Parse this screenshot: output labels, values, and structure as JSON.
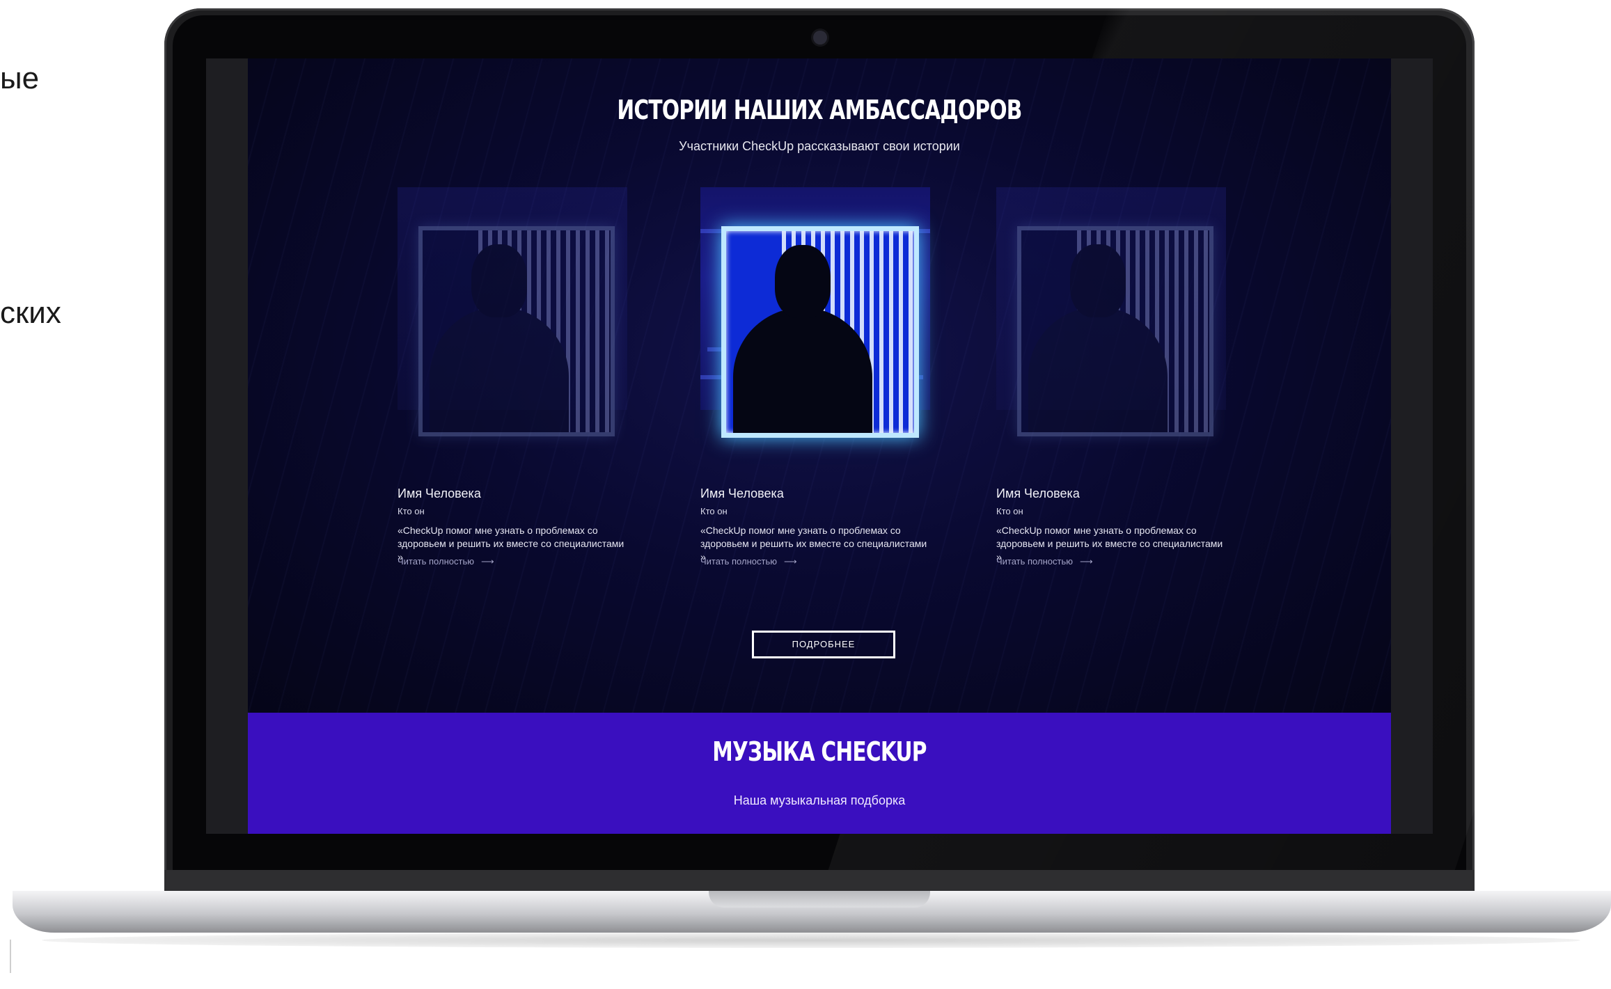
{
  "page_side_text": [
    "ые",
    "ских"
  ],
  "screen": {
    "stories": {
      "title": "ИСТОРИИ НАШИХ АМБАССАДОРОВ",
      "subtitle": "Участники CheckUp рассказывают свои истории",
      "cards": [
        {
          "name": "Имя Человека",
          "role": "Кто он",
          "quote": "«CheckUp помог мне узнать о проблемах со здоровьем и решить их вместе со специалистами »",
          "read_more": "Читать полностью",
          "arrow": "⟶",
          "state": "dim"
        },
        {
          "name": "Имя Человека",
          "role": "Кто он",
          "quote": "«CheckUp помог мне узнать о проблемах со здоровьем и решить их вместе со специалистами »",
          "read_more": "Читать полностью",
          "arrow": "⟶",
          "state": "active"
        },
        {
          "name": "Имя Человека",
          "role": "Кто он",
          "quote": "«CheckUp помог мне узнать о проблемах со здоровьем и решить их вместе со специалистами »",
          "read_more": "Читать полностью",
          "arrow": "⟶",
          "state": "dim"
        }
      ],
      "more_button": "ПОДРОБНЕЕ"
    },
    "music": {
      "title": "МУЗЫКА CHECKUP",
      "subtitle": "Наша музыкальная подборка"
    }
  },
  "colors": {
    "stories_bg": "#090930",
    "music_bg": "#3a0fbf",
    "active_frame": "#bfe8ff"
  }
}
